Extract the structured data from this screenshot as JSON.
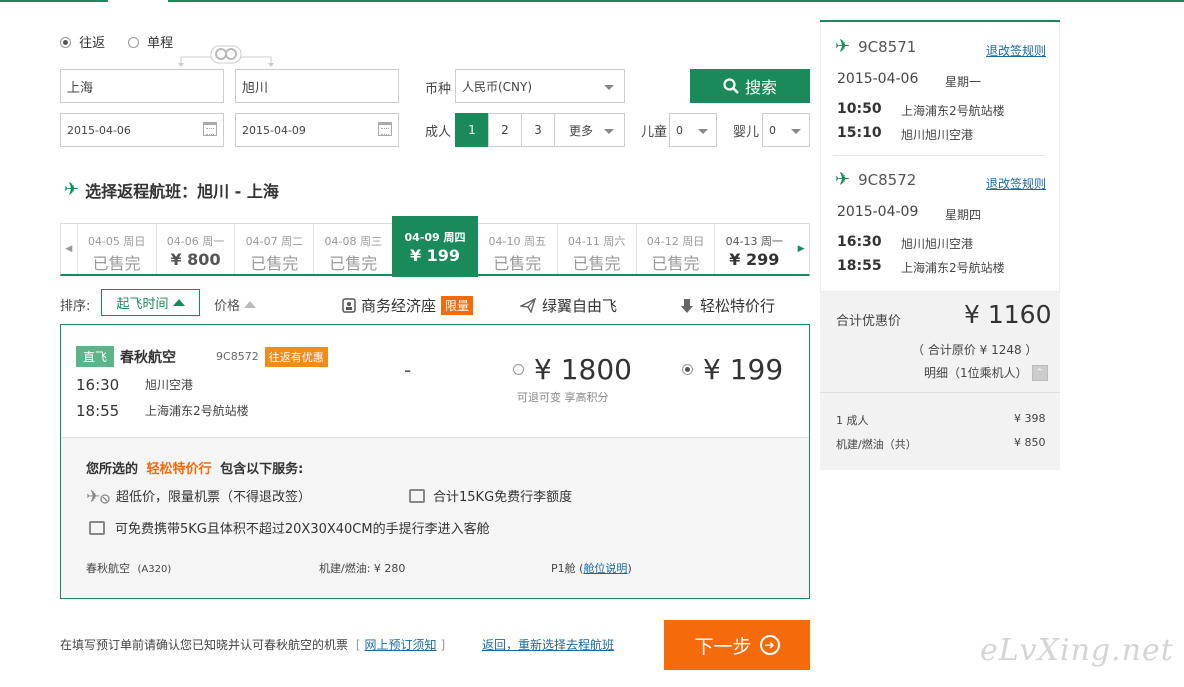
{
  "trip": {
    "roundtrip": "往返",
    "oneway": "单程"
  },
  "search": {
    "from": "上海",
    "to": "旭川",
    "date_out": "2015-04-06",
    "date_back": "2015-04-09",
    "currency_label": "币种",
    "currency": "人民币(CNY)",
    "adult_label": "成人",
    "adult_opts": [
      "1",
      "2",
      "3",
      "更多"
    ],
    "child_label": "儿童",
    "child_val": "0",
    "infant_label": "婴儿",
    "infant_val": "0",
    "button": "搜索"
  },
  "section_title": "选择返程航班：旭川 - 上海",
  "dates": [
    {
      "d": "04-05",
      "w": "周日",
      "p": "已售完"
    },
    {
      "d": "04-06",
      "w": "周一",
      "p": "¥ 800"
    },
    {
      "d": "04-07",
      "w": "周二",
      "p": "已售完"
    },
    {
      "d": "04-08",
      "w": "周三",
      "p": "已售完"
    },
    {
      "d": "04-09",
      "w": "周四",
      "p": "¥ 199"
    },
    {
      "d": "04-10",
      "w": "周五",
      "p": "已售完"
    },
    {
      "d": "04-11",
      "w": "周六",
      "p": "已售完"
    },
    {
      "d": "04-12",
      "w": "周日",
      "p": "已售完"
    },
    {
      "d": "04-13",
      "w": "周一",
      "p": "¥ 299"
    }
  ],
  "sort": {
    "label": "排序:",
    "dep": "起飞时间",
    "price": "价格"
  },
  "fare_classes": {
    "biz": "商务经济座",
    "biz_tag": "限量",
    "green": "绿翼自由飞",
    "easy": "轻松特价行"
  },
  "flight": {
    "direct": "直飞",
    "airline": "春秋航空",
    "no": "9C8572",
    "promo": "往返有优惠",
    "dep_time": "16:30",
    "dep_airport": "旭川空港",
    "arr_time": "18:55",
    "arr_airport": "上海浦东2号航站楼",
    "dash": "-",
    "price_a": "¥ 1800",
    "price_a_note": "可退可变 享高积分",
    "price_b": "¥ 199"
  },
  "detail": {
    "intro_pre": "您所选的",
    "intro_name": "轻松特价行",
    "intro_post": "包含以下服务:",
    "s1": "超低价，限量机票（不得退改签）",
    "s2": "合计15KG免费行李额度",
    "s3": "可免费携带5KG且体积不超过20X30X40CM的手提行李进入客舱",
    "aircraft": "春秋航空",
    "model": "(A320)",
    "tax": "机建/燃油: ¥ 280",
    "cabin": "P1舱",
    "cabin_link": "舱位说明"
  },
  "footer": {
    "note": "在填写预订单前请确认您已知晓并认可春秋航空的机票",
    "notice_link": "网上预订须知",
    "back_link": "返回，重新选择去程航班",
    "next": "下一步"
  },
  "summary": {
    "legs": [
      {
        "no": "9C8571",
        "rule": "退改签规则",
        "date": "2015-04-06",
        "week": "星期一",
        "t1": "10:50",
        "a1": "上海浦东2号航站楼",
        "t2": "15:10",
        "a2": "旭川旭川空港"
      },
      {
        "no": "9C8572",
        "rule": "退改签规则",
        "date": "2015-04-09",
        "week": "星期四",
        "t1": "16:30",
        "a1": "旭川旭川空港",
        "t2": "18:55",
        "a2": "上海浦东2号航站楼"
      }
    ],
    "total_label": "合计优惠价",
    "total": "¥ 1160",
    "orig": "（ 合计原价 ¥ 1248 ）",
    "detail_link": "明细（1位乘机人）",
    "rows": [
      {
        "k": "1 成人",
        "v": "¥ 398"
      },
      {
        "k": "机建/燃油（共）",
        "v": "¥ 850"
      }
    ]
  },
  "watermark": "eLvXing.net",
  "colors": {
    "brand": "#1a8a5a",
    "accent": "#f56a0a",
    "promo": "#f08c1a"
  }
}
